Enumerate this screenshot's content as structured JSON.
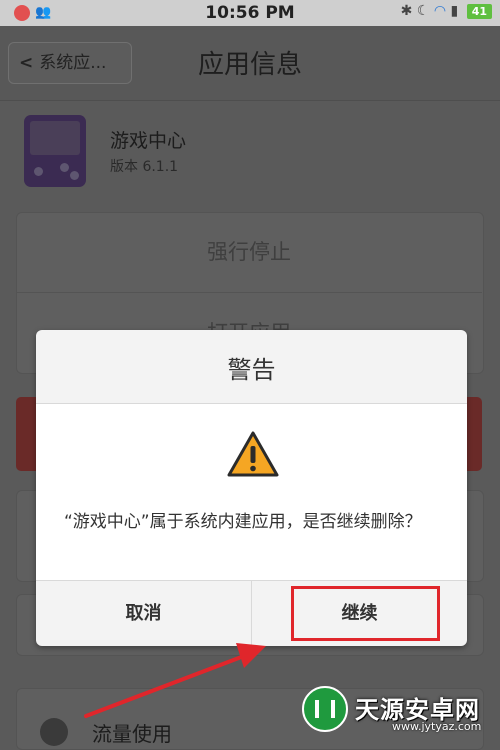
{
  "status_bar": {
    "time": "10:56 PM",
    "battery": "41"
  },
  "header": {
    "back_label": "系统应...",
    "title": "应用信息"
  },
  "app": {
    "name": "游戏中心",
    "version": "版本 6.1.1",
    "icon": "game-console-icon"
  },
  "actions": {
    "force_stop": "强行停止",
    "open_app": "打开应用"
  },
  "traffic_label": "流量使用",
  "dialog": {
    "title": "警告",
    "message": "“游戏中心”属于系统内建应用，是否继续删除？",
    "cancel_label": "取消",
    "continue_label": "继续",
    "icon": "warning-icon"
  },
  "watermark": {
    "title": "天源安卓网",
    "url": "www.jytyaz.com"
  },
  "colors": {
    "annotation": "#e0262b",
    "warning": "#f5a623",
    "watermark_green": "#1f9a3e"
  }
}
